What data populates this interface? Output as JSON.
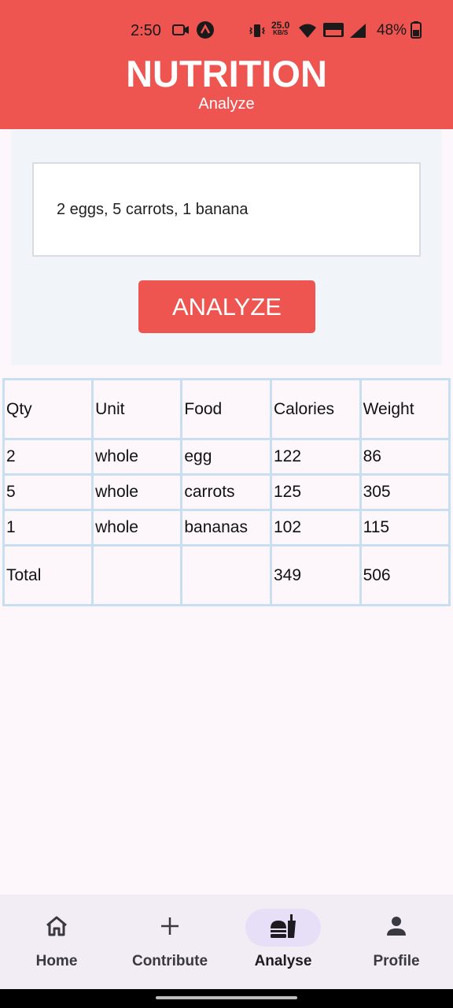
{
  "status_bar": {
    "time": "2:50",
    "speed_value": "25.0",
    "speed_unit": "KB/S",
    "battery": "48%"
  },
  "header": {
    "title": "NUTRITION",
    "subtitle": "Analyze"
  },
  "form": {
    "input_value": "2 eggs, 5 carrots, 1 banana",
    "analyze_label": "ANALYZE"
  },
  "table": {
    "headers": [
      "Qty",
      "Unit",
      "Food",
      "Calories",
      "Weight"
    ],
    "rows": [
      [
        "2",
        "whole",
        "egg",
        "122",
        "86"
      ],
      [
        "5",
        "whole",
        "carrots",
        "125",
        "305"
      ],
      [
        "1",
        "whole",
        "bananas",
        "102",
        "115"
      ]
    ],
    "total": [
      "Total",
      "",
      "",
      "349",
      "506"
    ]
  },
  "nav": {
    "items": [
      {
        "label": "Home",
        "icon": "home-icon"
      },
      {
        "label": "Contribute",
        "icon": "plus-icon"
      },
      {
        "label": "Analyse",
        "icon": "food-icon"
      },
      {
        "label": "Profile",
        "icon": "person-icon"
      }
    ],
    "active_index": 2
  },
  "colors": {
    "brand": "#ee5551",
    "table_border": "#c8dff2",
    "nav_active_pill": "#e7dff8"
  }
}
